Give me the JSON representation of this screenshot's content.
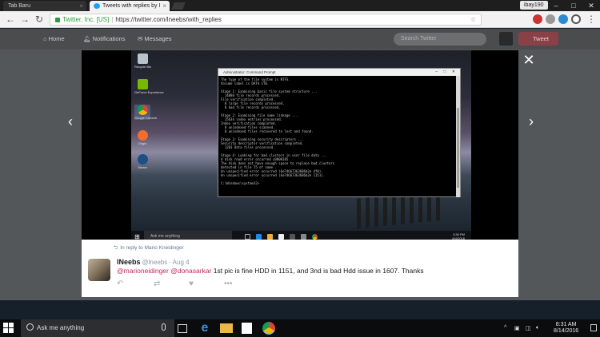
{
  "browser": {
    "tabs": [
      {
        "label": "Tab Baru"
      },
      {
        "label": "Tweets with replies by I"
      }
    ],
    "user_badge": "ibay190",
    "url_org": "Twitter, Inc. [US]",
    "url_sep": "|",
    "url": "https://twitter.com/lneebs/with_replies"
  },
  "twitter_nav": {
    "home": "Home",
    "notifications": "Notifications",
    "messages": "Messages",
    "search_placeholder": "Search Twitter",
    "tweet_button": "Tweet"
  },
  "cmd_window": {
    "title": "Administrator: Command Prompt",
    "lines": [
      "The type of the file system is NTFS.",
      "Volume label is DATA 1TB.",
      "",
      "Stage 1: Examining basic file system structure ...",
      "  14080 file records processed.",
      "File verification completed.",
      "  0 large file records processed.",
      "  0 bad file records processed.",
      "",
      "Stage 2: Examining file name linkage ...",
      "  15634 index entries processed.",
      "Index verification completed.",
      "  0 unindexed files scanned.",
      "  0 unindexed files recovered to lost and found.",
      "",
      "Stage 3: Examining security descriptors ...",
      "Security descriptor verification completed.",
      "  1203 data files processed.",
      "",
      "Stage 4: Looking for bad clusters in user file data ...",
      "A disk read error occurred c0000185",
      "The disk does not have enough space to replace bad clusters",
      "detected in file 75 of name .",
      "An unspecified error occurred (6e74667363686b2e 4f0).",
      "An unspecified error occurred (6e74667363686b2e 1151).",
      "",
      "C:\\Windows\\system32>"
    ]
  },
  "inner_desktop": {
    "icons": [
      "Recycle Bin",
      "GeForce Experience",
      "Google Chrome",
      "Origin",
      "Steam"
    ],
    "taskbar_search": "Ask me anything",
    "clock_time": "3:36 PM",
    "clock_date": "8/4/2016"
  },
  "tweet": {
    "reply_to": "In reply to Mario Kneidinger",
    "name": "lNeebs",
    "handle": "@lneebs",
    "date": "· Aug 4",
    "mentions": "@marioneidinger @donasarkar",
    "text": " 1st pic is fine HDD in 1151, and 3nd is bad Hdd issue in 1607. Thanks"
  },
  "windows_taskbar": {
    "search_placeholder": "Ask me anything",
    "time": "8:31 AM",
    "date": "8/14/2016"
  },
  "colors": {
    "mention": "#c0265f",
    "twitter_blue": "#1da1f2",
    "tweet_button": "#8a4047"
  },
  "icons": [
    "back-arrow-icon",
    "forward-arrow-icon",
    "refresh-icon",
    "lock-icon",
    "star-icon",
    "close-icon",
    "chevron-left-icon",
    "chevron-right-icon",
    "reply-icon",
    "retweet-icon",
    "heart-icon",
    "more-icon",
    "windows-start-icon",
    "search-icon",
    "microphone-icon",
    "task-view-icon",
    "edge-icon",
    "file-explorer-icon",
    "store-icon",
    "chrome-icon"
  ]
}
